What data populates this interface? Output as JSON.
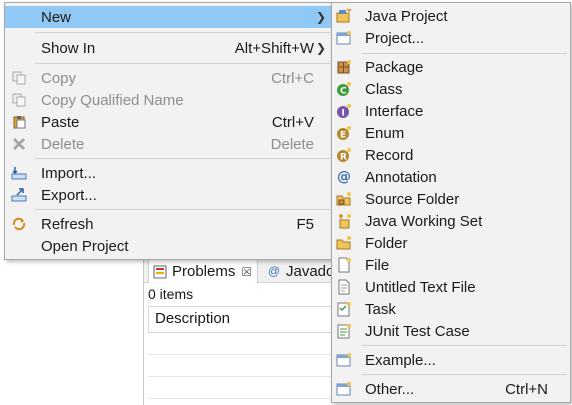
{
  "context_menu": {
    "items": [
      {
        "label": "New",
        "shortcut": "",
        "submenu": true,
        "highlighted": true,
        "enabled": true,
        "icon": null
      },
      {
        "label": "Show In",
        "shortcut": "Alt+Shift+W",
        "submenu": true,
        "enabled": true,
        "icon": null
      },
      {
        "label": "Copy",
        "shortcut": "Ctrl+C",
        "enabled": false,
        "icon": "copy-icon"
      },
      {
        "label": "Copy Qualified Name",
        "shortcut": "",
        "enabled": false,
        "icon": "copy-qualified-name-icon"
      },
      {
        "label": "Paste",
        "shortcut": "Ctrl+V",
        "enabled": true,
        "icon": "paste-icon"
      },
      {
        "label": "Delete",
        "shortcut": "Delete",
        "enabled": false,
        "icon": "delete-icon"
      },
      {
        "label": "Import...",
        "shortcut": "",
        "enabled": true,
        "icon": "import-icon"
      },
      {
        "label": "Export...",
        "shortcut": "",
        "enabled": true,
        "icon": "export-icon"
      },
      {
        "label": "Refresh",
        "shortcut": "F5",
        "enabled": true,
        "icon": "refresh-icon"
      },
      {
        "label": "Open Project",
        "shortcut": "",
        "enabled": true,
        "icon": null
      }
    ]
  },
  "new_submenu": {
    "items": [
      {
        "label": "Java Project",
        "shortcut": "",
        "icon": "java-project-icon"
      },
      {
        "label": "Project...",
        "shortcut": "",
        "icon": "project-icon"
      },
      {
        "label": "Package",
        "shortcut": "",
        "icon": "package-icon"
      },
      {
        "label": "Class",
        "shortcut": "",
        "icon": "class-icon"
      },
      {
        "label": "Interface",
        "shortcut": "",
        "icon": "interface-icon"
      },
      {
        "label": "Enum",
        "shortcut": "",
        "icon": "enum-icon"
      },
      {
        "label": "Record",
        "shortcut": "",
        "icon": "record-icon"
      },
      {
        "label": "Annotation",
        "shortcut": "",
        "icon": "annotation-icon"
      },
      {
        "label": "Source Folder",
        "shortcut": "",
        "icon": "source-folder-icon"
      },
      {
        "label": "Java Working Set",
        "shortcut": "",
        "icon": "java-working-set-icon"
      },
      {
        "label": "Folder",
        "shortcut": "",
        "icon": "folder-icon"
      },
      {
        "label": "File",
        "shortcut": "",
        "icon": "file-icon"
      },
      {
        "label": "Untitled Text File",
        "shortcut": "",
        "icon": "untitled-text-file-icon"
      },
      {
        "label": "Task",
        "shortcut": "",
        "icon": "task-icon"
      },
      {
        "label": "JUnit Test Case",
        "shortcut": "",
        "icon": "junit-test-case-icon"
      },
      {
        "label": "Example...",
        "shortcut": "",
        "icon": "example-icon"
      },
      {
        "label": "Other...",
        "shortcut": "Ctrl+N",
        "icon": "other-icon"
      }
    ]
  },
  "problems_view": {
    "tabs": [
      {
        "label": "Problems",
        "close": "☒",
        "active": true,
        "icon": "problems-icon"
      },
      {
        "label": "Javado",
        "active": false,
        "icon": "javadoc-icon"
      }
    ],
    "status": "0 items",
    "columns": [
      "Description"
    ]
  },
  "colors": {
    "menu_background": "#f2f2f2",
    "highlight": "#90c8f6",
    "disabled_text": "#8e8e8e",
    "separator": "#d0d0d0"
  }
}
